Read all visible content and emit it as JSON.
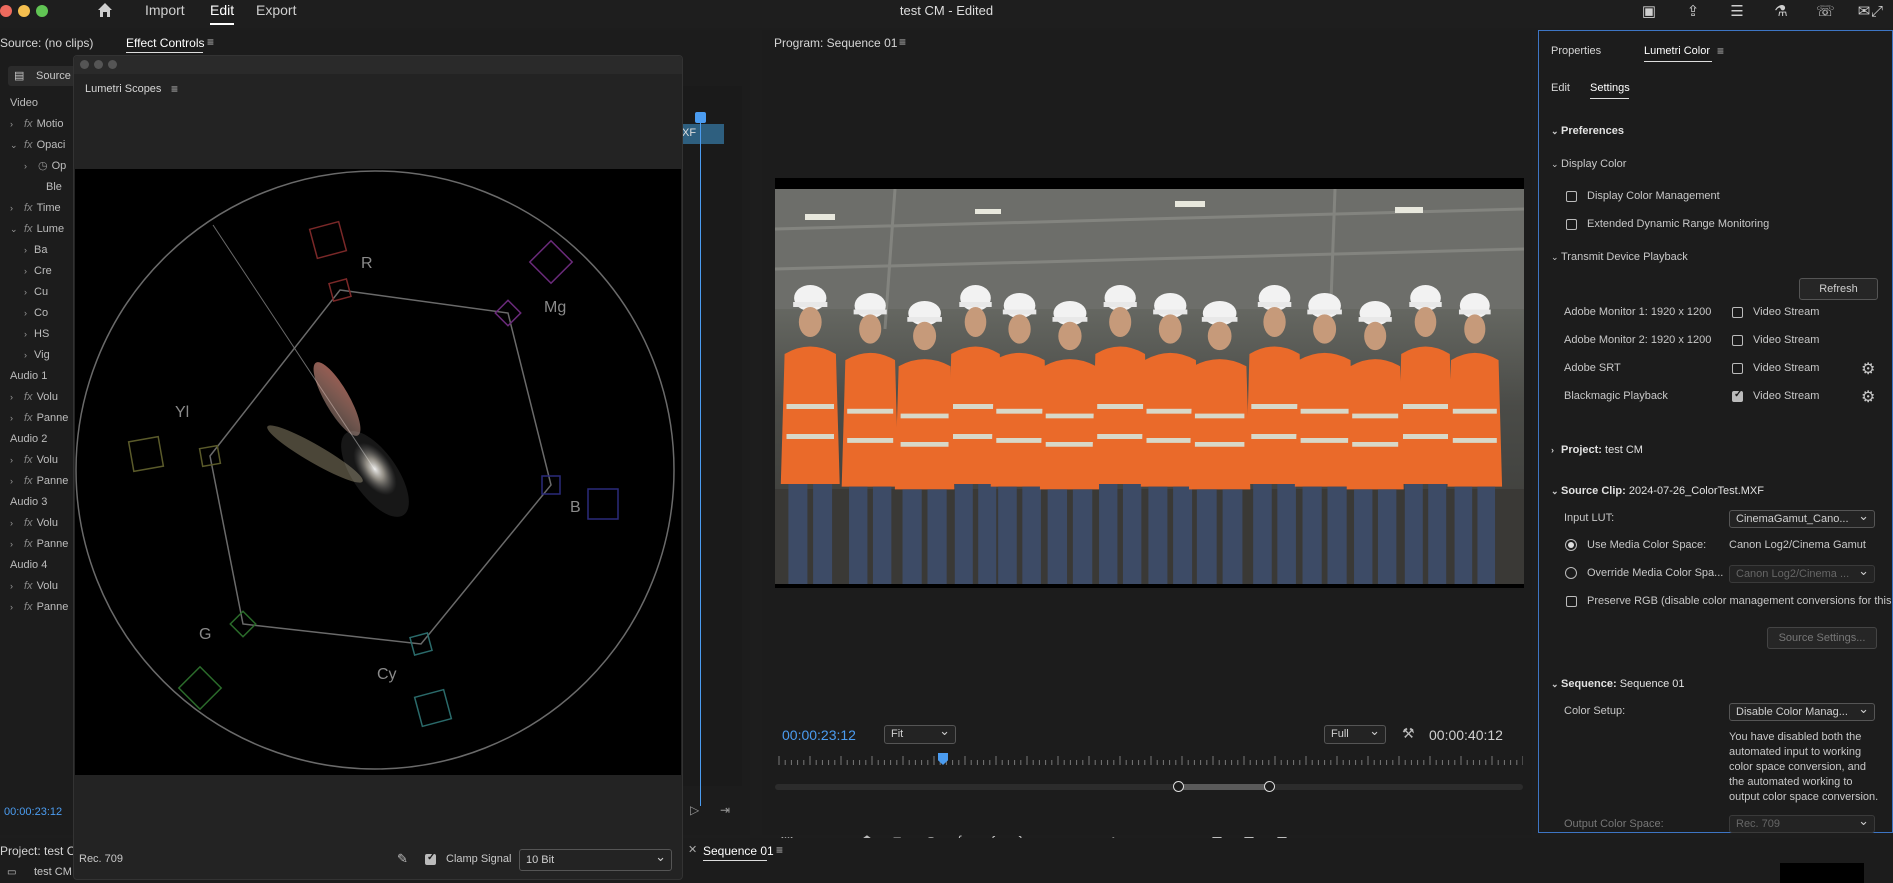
{
  "app": {
    "title": "test CM - Edited",
    "workspaces": [
      "Import",
      "Edit",
      "Export"
    ],
    "active_workspace": "Edit",
    "traffic_colors": [
      "#ed6a5e",
      "#f5bf4f",
      "#61c554"
    ]
  },
  "source_panel": {
    "title": "Source: (no clips)",
    "tab_effect_controls": "Effect Controls",
    "source_tab": "Source",
    "clip_label": "XF",
    "rows": [
      {
        "label": "Video",
        "indent": 0,
        "fx": false,
        "tri": ""
      },
      {
        "label": "Motio",
        "indent": 1,
        "fx": true,
        "tri": "›"
      },
      {
        "label": "Opaci",
        "indent": 1,
        "fx": true,
        "tri": "⌄"
      },
      {
        "label": "Op",
        "indent": 2,
        "fx": false,
        "tri": "›"
      },
      {
        "label": "Ble",
        "indent": 3,
        "fx": false,
        "tri": ""
      },
      {
        "label": "Time",
        "indent": 1,
        "fx": true,
        "tri": "›"
      },
      {
        "label": "Lume",
        "indent": 1,
        "fx": true,
        "tri": "⌄"
      },
      {
        "label": "Ba",
        "indent": 2,
        "fx": false,
        "tri": "›"
      },
      {
        "label": "Cre",
        "indent": 2,
        "fx": false,
        "tri": "›"
      },
      {
        "label": "Cu",
        "indent": 2,
        "fx": false,
        "tri": "›"
      },
      {
        "label": "Co",
        "indent": 2,
        "fx": false,
        "tri": "›"
      },
      {
        "label": "HS",
        "indent": 2,
        "fx": false,
        "tri": "›"
      },
      {
        "label": "Vig",
        "indent": 2,
        "fx": false,
        "tri": "›"
      },
      {
        "label": "Audio 1",
        "indent": 0,
        "fx": false,
        "tri": ""
      },
      {
        "label": "Volu",
        "indent": 1,
        "fx": true,
        "tri": "›"
      },
      {
        "label": "Panne",
        "indent": 1,
        "fx": true,
        "tri": "›"
      },
      {
        "label": "Audio 2",
        "indent": 0,
        "fx": false,
        "tri": ""
      },
      {
        "label": "Volu",
        "indent": 1,
        "fx": true,
        "tri": "›"
      },
      {
        "label": "Panne",
        "indent": 1,
        "fx": true,
        "tri": "›"
      },
      {
        "label": "Audio 3",
        "indent": 0,
        "fx": false,
        "tri": ""
      },
      {
        "label": "Volu",
        "indent": 1,
        "fx": true,
        "tri": "›"
      },
      {
        "label": "Panne",
        "indent": 1,
        "fx": true,
        "tri": "›"
      },
      {
        "label": "Audio 4",
        "indent": 0,
        "fx": false,
        "tri": ""
      },
      {
        "label": "Volu",
        "indent": 1,
        "fx": true,
        "tri": "›"
      },
      {
        "label": "Panne",
        "indent": 1,
        "fx": true,
        "tri": "›"
      }
    ],
    "timecode": "00:00:23:12"
  },
  "scopes": {
    "title": "Lumetri Scopes",
    "targets": [
      "R",
      "Mg",
      "B",
      "Cy",
      "G",
      "Yl"
    ],
    "bottom_left": "Rec. 709",
    "clamp_label": "Clamp Signal",
    "clamp_checked": true,
    "bit_depth": "10 Bit",
    "colors": {
      "R": "#7a2828",
      "Mg": "#6a2a7a",
      "B": "#2a2a7a",
      "Cy": "#2a6a6a",
      "G": "#2a6a2a",
      "Yl": "#5a5a2a"
    }
  },
  "program": {
    "title": "Program: Sequence 01",
    "timecode_current": "00:00:23:12",
    "zoom": "Fit",
    "quality": "Full",
    "timecode_duration": "00:00:40:12",
    "playhead_pos": 0.22
  },
  "bottom_bar": {
    "project": "Project: test CM",
    "project_item": "test CM",
    "sequence_tab": "Sequence 01"
  },
  "lumetri": {
    "tab_properties": "Properties",
    "tab_lumetri": "Lumetri Color",
    "subtab_edit": "Edit",
    "subtab_settings": "Settings",
    "preferences": "Preferences",
    "display_color": "Display Color",
    "display_color_mgmt": "Display Color Management",
    "edr_monitoring": "Extended Dynamic Range Monitoring",
    "transmit": "Transmit Device Playback",
    "refresh": "Refresh",
    "devices": [
      {
        "name": "Adobe Monitor 1: 1920 x 1200",
        "stream": "Video Stream",
        "checked": false,
        "gear": false
      },
      {
        "name": "Adobe Monitor 2: 1920 x 1200",
        "stream": "Video Stream",
        "checked": false,
        "gear": false
      },
      {
        "name": "Adobe SRT",
        "stream": "Video Stream",
        "checked": false,
        "gear": true
      },
      {
        "name": "Blackmagic Playback",
        "stream": "Video Stream",
        "checked": true,
        "gear": true
      }
    ],
    "project_label": "Project:",
    "project_value": "test CM",
    "source_clip_label": "Source Clip:",
    "source_clip_value": "2024-07-26_ColorTest.MXF",
    "input_lut_label": "Input LUT:",
    "input_lut_value": "CinemaGamut_Cano...",
    "use_media_cs": "Use Media Color Space:",
    "use_media_cs_value": "Canon Log2/Cinema Gamut",
    "override_cs": "Override Media Color Spa...",
    "override_cs_value": "Canon Log2/Cinema ...",
    "preserve_rgb": "Preserve RGB (disable color management conversions for this i...",
    "source_settings": "Source Settings...",
    "sequence_label": "Sequence:",
    "sequence_value": "Sequence 01",
    "color_setup_label": "Color Setup:",
    "color_setup_value": "Disable Color Manag...",
    "color_setup_note": "You have disabled both the automated input to working color space conversion, and the automated working to output color space conversion.",
    "output_cs_label": "Output Color Space:",
    "output_cs_value": "Rec. 709"
  }
}
